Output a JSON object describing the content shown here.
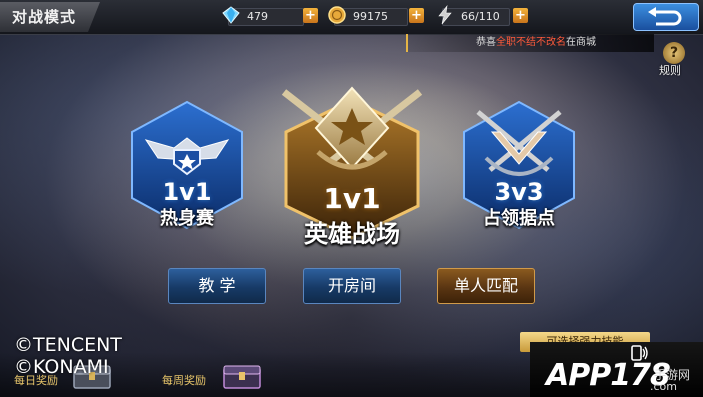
{
  "header": {
    "title": "对战模式",
    "gems": "479",
    "coins": "99175",
    "energy": "66/110",
    "plus": "+"
  },
  "ticker": {
    "prefix": "恭喜",
    "highlight": "全职不结不改名",
    "suffix": "在商城"
  },
  "rules": {
    "label": "规则",
    "icon_text": "?"
  },
  "modes": [
    {
      "num": "1v1",
      "name": "热身赛"
    },
    {
      "num": "1v1",
      "name": "英雄战场"
    },
    {
      "num": "3v3",
      "name": "占领据点"
    }
  ],
  "buttons": {
    "tutorial": "教 学",
    "create_room": "开房间",
    "solo_match": "单人匹配"
  },
  "bottom": {
    "skill_button": "可选择强力技能",
    "daily_reward": "每日奖励",
    "weekly_reward": "每周奖励"
  },
  "copyright": {
    "line1": "©TENCENT",
    "line2": "©KONAMI"
  },
  "watermark": {
    "text": "APP178",
    "sub": ".com",
    "tag": "手游网"
  },
  "colors": {
    "blue_glow": "#2f7fe6",
    "gold": "#c9922f",
    "accent_red": "#ff5a3a"
  }
}
